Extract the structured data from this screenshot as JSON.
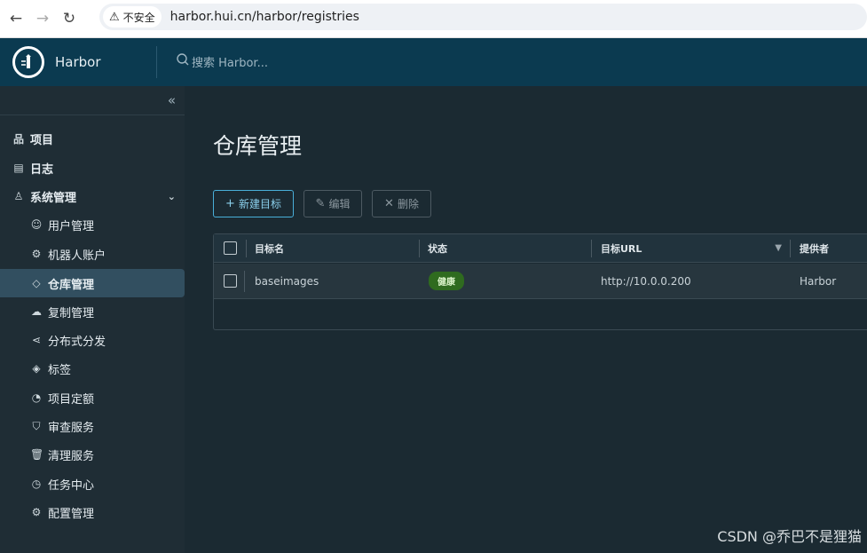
{
  "browser": {
    "back_icon": "arrow-left-icon",
    "forward_icon": "arrow-right-icon",
    "reload_icon": "reload-icon",
    "insecure_label": "不安全",
    "url": "harbor.hui.cn/harbor/registries"
  },
  "header": {
    "app_name": "Harbor",
    "search_placeholder": "搜索 Harbor..."
  },
  "sidebar": {
    "collapse_icon": "double-chevron-left-icon",
    "items": [
      {
        "label": "项目",
        "icon": "projects-icon",
        "level": 1
      },
      {
        "label": "日志",
        "icon": "logs-icon",
        "level": 1
      },
      {
        "label": "系统管理",
        "icon": "admin-icon",
        "level": 1,
        "expanded": true
      },
      {
        "label": "用户管理",
        "icon": "users-icon",
        "level": 2
      },
      {
        "label": "机器人账户",
        "icon": "robot-icon",
        "level": 2
      },
      {
        "label": "仓库管理",
        "icon": "registry-icon",
        "level": 2,
        "active": true
      },
      {
        "label": "复制管理",
        "icon": "cloud-icon",
        "level": 2
      },
      {
        "label": "分布式分发",
        "icon": "share-icon",
        "level": 2
      },
      {
        "label": "标签",
        "icon": "tag-icon",
        "level": 2
      },
      {
        "label": "项目定额",
        "icon": "dashboard-icon",
        "level": 2
      },
      {
        "label": "审查服务",
        "icon": "shield-icon",
        "level": 2
      },
      {
        "label": "清理服务",
        "icon": "trash-icon",
        "level": 2
      },
      {
        "label": "任务中心",
        "icon": "gauge-icon",
        "level": 2
      },
      {
        "label": "配置管理",
        "icon": "gear-icon",
        "level": 2
      }
    ]
  },
  "main": {
    "title": "仓库管理",
    "buttons": {
      "new": "新建目标",
      "edit": "编辑",
      "delete": "删除"
    },
    "table": {
      "columns": [
        "目标名",
        "状态",
        "目标URL",
        "提供者"
      ],
      "rows": [
        {
          "name": "baseimages",
          "status": "健康",
          "url": "http://10.0.0.200",
          "provider": "Harbor"
        }
      ]
    }
  },
  "watermark": "CSDN @乔巴不是狸猫",
  "colors": {
    "header_bg": "#0b3a50",
    "sidebar_bg": "#1f2d35",
    "main_bg": "#1b2a32",
    "active_item_bg": "#324f60",
    "accent": "#49afd9",
    "healthy_badge": "#2f6b1f"
  }
}
